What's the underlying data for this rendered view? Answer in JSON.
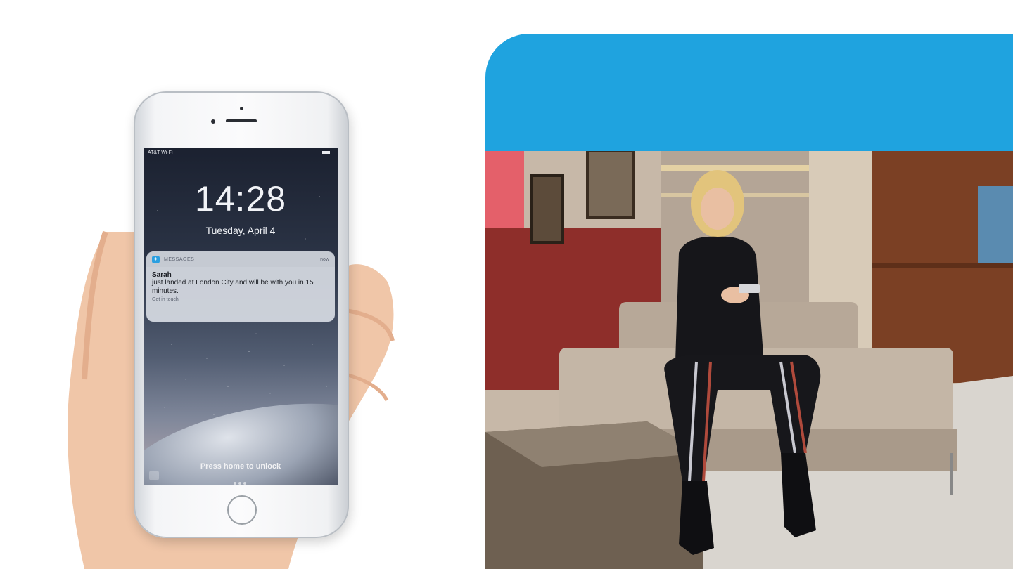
{
  "phone": {
    "status_carrier": "AT&T Wi-Fi",
    "time": "14:28",
    "date": "Tuesday, April 4",
    "notification": {
      "app_name": "MESSAGES",
      "when": "now",
      "sender": "Sarah",
      "message": "just landed at London City and will be with you in 15 minutes.",
      "action": "Get in touch"
    },
    "unlock_text": "Press home to unlock"
  },
  "colors": {
    "blue_band": "#1fa3df",
    "app_icon": "#2a9fe0"
  },
  "icons": [
    "camera-icon",
    "battery-icon",
    "home-button-icon",
    "app-icon"
  ]
}
